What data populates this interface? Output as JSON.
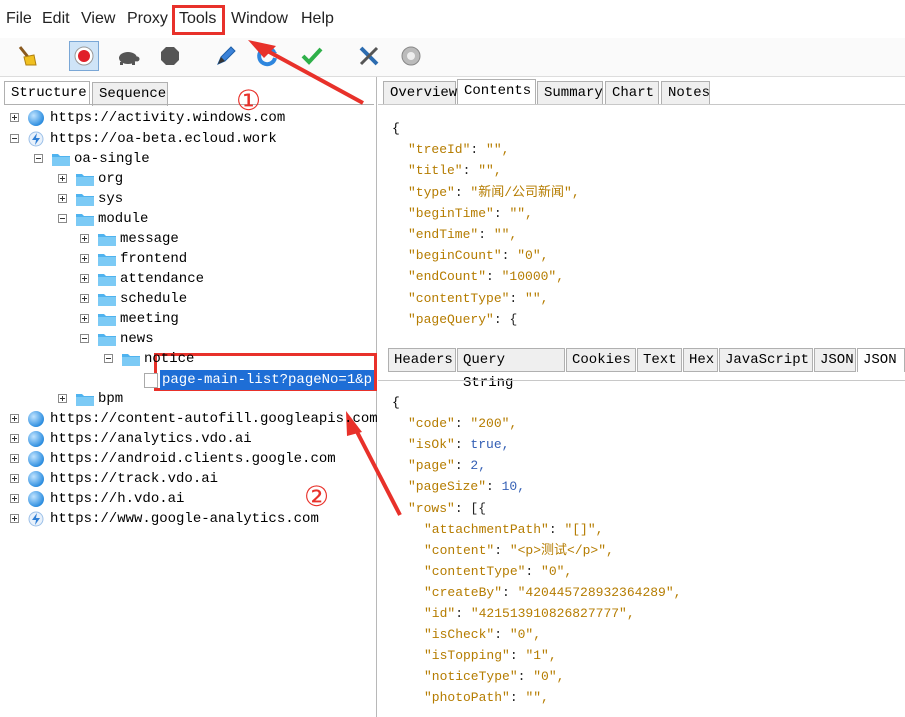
{
  "menu": [
    "File",
    "Edit",
    "View",
    "Proxy",
    "Tools",
    "Window",
    "Help"
  ],
  "toolbar_icons": [
    "broom-icon",
    "record-icon",
    "turtle-icon",
    "stop-icon",
    "pen-icon",
    "refresh-icon",
    "check-icon",
    "tools-icon",
    "settings-icon"
  ],
  "left_tabs": [
    "Structure",
    "Sequence"
  ],
  "tree": {
    "nodes": [
      {
        "label": "https://activity.windows.com",
        "icon": "globe"
      },
      {
        "label": "https://oa-beta.ecloud.work",
        "icon": "bolt"
      },
      {
        "label": "oa-single",
        "icon": "folder"
      },
      {
        "label": "org",
        "icon": "folder"
      },
      {
        "label": "sys",
        "icon": "folder"
      },
      {
        "label": "module",
        "icon": "folder"
      },
      {
        "label": "message",
        "icon": "folder"
      },
      {
        "label": "frontend",
        "icon": "folder"
      },
      {
        "label": "attendance",
        "icon": "folder"
      },
      {
        "label": "schedule",
        "icon": "folder"
      },
      {
        "label": "meeting",
        "icon": "folder"
      },
      {
        "label": "news",
        "icon": "folder"
      },
      {
        "label": "notice",
        "icon": "folder"
      },
      {
        "label": "page-main-list?pageNo=1&p",
        "icon": "file"
      },
      {
        "label": "bpm",
        "icon": "folder"
      },
      {
        "label": "https://content-autofill.googleapis.com",
        "icon": "globe"
      },
      {
        "label": "https://analytics.vdo.ai",
        "icon": "globe"
      },
      {
        "label": "https://android.clients.google.com",
        "icon": "globe"
      },
      {
        "label": "https://track.vdo.ai",
        "icon": "globe"
      },
      {
        "label": "https://h.vdo.ai",
        "icon": "globe"
      },
      {
        "label": "https://www.google-analytics.com",
        "icon": "bolt"
      }
    ]
  },
  "right_tabs": [
    "Overview",
    "Contents",
    "Summary",
    "Chart",
    "Notes"
  ],
  "request_lines": [
    "{",
    "\"treeId\": \"\",",
    "\"title\": \"\",",
    "\"type\": \"新闻/公司新闻\",",
    "\"beginTime\": \"\",",
    "\"endTime\": \"\",",
    "\"beginCount\": \"0\",",
    "\"endCount\": \"10000\",",
    "\"contentType\": \"\",",
    "\"pageQuery\": {"
  ],
  "response_tabs": [
    "Headers",
    "Query String",
    "Cookies",
    "Text",
    "Hex",
    "JavaScript",
    "JSON",
    "JSON"
  ],
  "response_lines": [
    "{",
    "\"code\": \"200\",",
    "\"isOk\": true,",
    "\"page\": 2,",
    "\"pageSize\": 10,",
    "\"rows\": [{",
    "\"attachmentPath\": \"[]\",",
    "\"content\": \"<p>测试</p>\",",
    "\"contentType\": \"0\",",
    "\"createBy\": \"420445728932364289\",",
    "\"id\": \"421513910826827777\",",
    "\"isCheck\": \"0\",",
    "\"isTopping\": \"1\",",
    "\"noticeType\": \"0\",",
    "\"photoPath\": \"\","
  ],
  "annotations": {
    "marker1": "①",
    "marker2": "②"
  },
  "colors": {
    "annotation": "#e8312a",
    "selection": "#1e6ed6",
    "json_key": "#b57c00",
    "json_value": "#3560b5"
  }
}
